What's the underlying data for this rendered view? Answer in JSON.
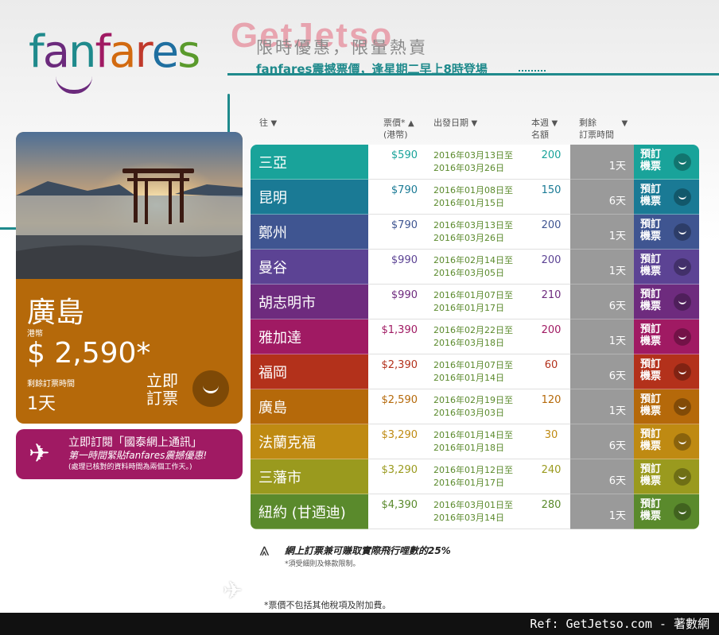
{
  "logo": {
    "letters": [
      "f",
      "a",
      "n",
      "f",
      "a",
      "r",
      "e",
      "s"
    ],
    "colors": [
      "#1f8a8c",
      "#6b2a7c",
      "#1f8a8c",
      "#a01a63",
      "#d26a10",
      "#c0392b",
      "#1f6fa0",
      "#5a9a2c"
    ]
  },
  "watermark": "GetJetso",
  "headline": "限時優惠，限量熱賣",
  "subline": "fanfares震撼票價，逢星期二早上8時登場",
  "headers": {
    "destination": "往",
    "price": "票價*",
    "price_unit": "(港幣)",
    "depart": "出發日期",
    "quota_1": "本週",
    "quota_2": "名額",
    "remain_1": "剩餘",
    "remain_2": "訂票時間"
  },
  "featured": {
    "city": "廣島",
    "currency": "港幣",
    "price": "$ 2,590*",
    "remain_label": "剩餘訂票時間",
    "remain": "1天",
    "book_1": "立即",
    "book_2": "訂票"
  },
  "subscribe": {
    "line1": "立即訂閱「國泰網上通訊」",
    "line2": "第一時間緊貼fanfares震撼優惠!",
    "line3": "(處理已核對的資料時間為兩個工作天。)"
  },
  "book_label_1": "預訂",
  "book_label_2": "機票",
  "rows": [
    {
      "city": "三亞",
      "price": "$590",
      "d1": "2016年03月13日至",
      "d2": "2016年03月26日",
      "quota": "200",
      "remain": "1天",
      "color": "#19a39a"
    },
    {
      "city": "昆明",
      "price": "$790",
      "d1": "2016年01月08日至",
      "d2": "2016年01月15日",
      "quota": "150",
      "remain": "6天",
      "color": "#1a7a95"
    },
    {
      "city": "鄭州",
      "price": "$790",
      "d1": "2016年03月13日至",
      "d2": "2016年03月26日",
      "quota": "200",
      "remain": "1天",
      "color": "#3f5591"
    },
    {
      "city": "曼谷",
      "price": "$990",
      "d1": "2016年02月14日至",
      "d2": "2016年03月05日",
      "quota": "200",
      "remain": "1天",
      "color": "#5c4394"
    },
    {
      "city": "胡志明市",
      "price": "$990",
      "d1": "2016年01月07日至",
      "d2": "2016年01月17日",
      "quota": "210",
      "remain": "6天",
      "color": "#6e2b7e"
    },
    {
      "city": "雅加達",
      "price": "$1,390",
      "d1": "2016年02月22日至",
      "d2": "2016年03月18日",
      "quota": "200",
      "remain": "1天",
      "color": "#a01a63"
    },
    {
      "city": "福岡",
      "price": "$2,390",
      "d1": "2016年01月07日至",
      "d2": "2016年01月14日",
      "quota": "60",
      "remain": "6天",
      "color": "#b3311b"
    },
    {
      "city": "廣島",
      "price": "$2,590",
      "d1": "2016年02月19日至",
      "d2": "2016年03月03日",
      "quota": "120",
      "remain": "1天",
      "color": "#b5690a"
    },
    {
      "city": "法蘭克福",
      "price": "$3,290",
      "d1": "2016年01月14日至",
      "d2": "2016年01月18日",
      "quota": "30",
      "remain": "6天",
      "color": "#bf8a12"
    },
    {
      "city": "三藩市",
      "price": "$3,290",
      "d1": "2016年01月12日至",
      "d2": "2016年01月17日",
      "quota": "240",
      "remain": "6天",
      "color": "#9a9a1e"
    },
    {
      "city": "紐約 (甘迺迪)",
      "price": "$4,390",
      "d1": "2016年03月01日至",
      "d2": "2016年03月14日",
      "quota": "280",
      "remain": "1天",
      "color": "#5a8a2c"
    }
  ],
  "miles": "網上訂票兼可賺取實際飛行哩數的25%",
  "miles_note": "*須受細則及條款限制。",
  "footnote": "*票價不包括其他稅項及附加費。",
  "credit": "Ref: GetJetso.com - 著數網"
}
